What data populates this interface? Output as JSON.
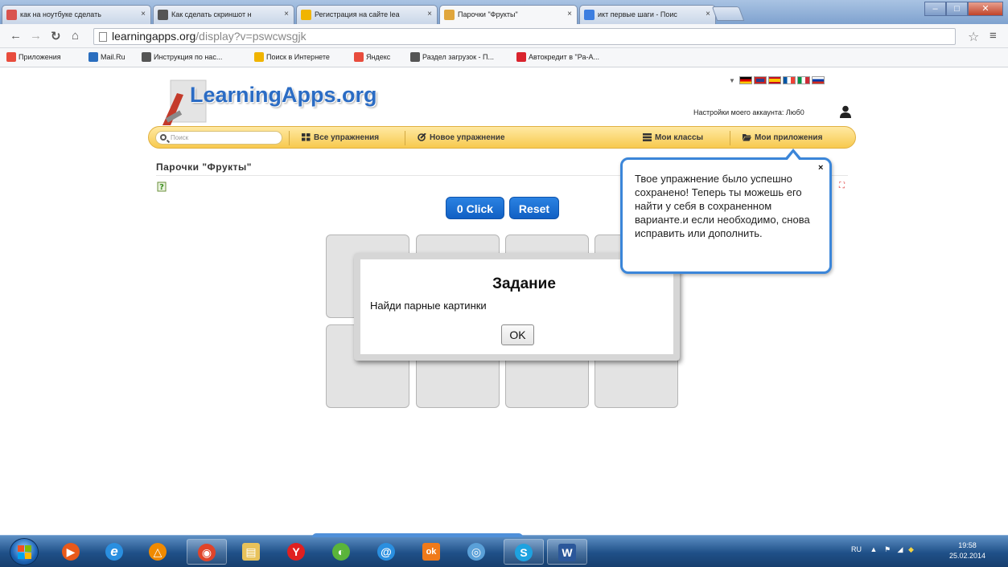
{
  "browser": {
    "tabs": [
      {
        "title": "как на ноутбуке сделать",
        "color": "#d9534f"
      },
      {
        "title": "Как сделать скриншот н",
        "color": "#555555"
      },
      {
        "title": "Регистрация на сайте lea",
        "color": "#f0b400"
      },
      {
        "title": "Парочки \"Фрукты\"",
        "color": "#e0a63c",
        "active": true
      },
      {
        "title": "икт первые шаги - Поис",
        "color": "#3d7ee0"
      }
    ],
    "tab_close": "×",
    "url_host": "learningapps.org",
    "url_path": "/display?v=pswcwsgjk",
    "bookmarks": [
      {
        "label": "Приложения",
        "color": "#e84c3d"
      },
      {
        "label": "Mail.Ru",
        "color": "#2a6ebf"
      },
      {
        "label": "Инструкция по нас...",
        "color": "#555555"
      },
      {
        "label": "Поиск в Интернете",
        "color": "#f0b400"
      },
      {
        "label": "Яндекс",
        "color": "#e84c3d"
      },
      {
        "label": "Раздел загрузок - П...",
        "color": "#555555"
      },
      {
        "label": "Автокредит в \"Ра-А...",
        "color": "#d9232d"
      }
    ]
  },
  "site": {
    "logo": "LearningApps.org",
    "account_label": "Настройки моего аккаунта: Люб0",
    "search_placeholder": "Поиск",
    "nav": {
      "all": "Все упражнения",
      "new": "Новое упражнение",
      "classes": "Мои классы",
      "apps": "Мои приложения"
    },
    "app_title": "Парочки \"Фрукты\"",
    "click_counter": "0 Click",
    "reset": "Reset",
    "dialog": {
      "title": "Задание",
      "text": "Найди парные картинки",
      "ok": "OK"
    },
    "bubble": {
      "text": "Твое упражнение было успешно сохранено! Теперь ты можешь его найти у себя в сохраненном варианте.и если необходимо, снова исправить или дополнить.",
      "close": "×"
    }
  },
  "taskbar": {
    "apps": [
      {
        "name": "media",
        "glyph": "▶",
        "color": "#e8591a"
      },
      {
        "name": "ie",
        "glyph": "e",
        "color": "#2a8fe0"
      },
      {
        "name": "avast",
        "glyph": "△",
        "color": "#f08a00"
      },
      {
        "name": "chrome",
        "glyph": "◉",
        "color": "#e0442a",
        "pinned": true
      },
      {
        "name": "explorer",
        "glyph": "▤",
        "color": "#e8c25a"
      },
      {
        "name": "yandex",
        "glyph": "Y",
        "color": "#e02020"
      },
      {
        "name": "winamp",
        "glyph": "◐",
        "color": "#5ab43a"
      },
      {
        "name": "mail-agent",
        "glyph": "@",
        "color": "#2a8fe0"
      },
      {
        "name": "odnoklassniki",
        "glyph": "ok",
        "color": "#f07a1a"
      },
      {
        "name": "network",
        "glyph": "◎",
        "color": "#5aa0d8"
      },
      {
        "name": "skype",
        "glyph": "S",
        "color": "#1ea2e0",
        "pinned": true
      },
      {
        "name": "word",
        "glyph": "W",
        "color": "#2b579a",
        "pinned": true
      }
    ],
    "lang": "RU",
    "time": "19:58",
    "date": "25.02.2014"
  }
}
